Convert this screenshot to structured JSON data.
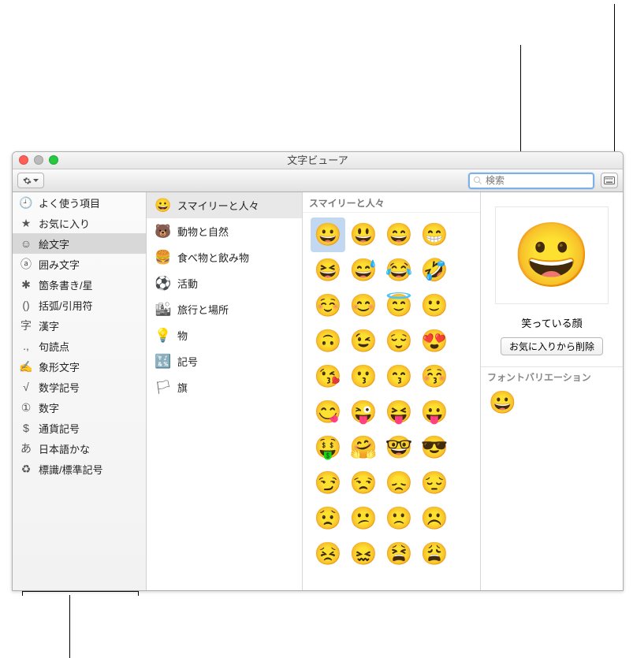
{
  "window_title": "文字ビューア",
  "search_placeholder": "検索",
  "sidebar1": [
    {
      "icon": "🕘",
      "label": "よく使う項目"
    },
    {
      "icon": "★",
      "label": "お気に入り"
    },
    {
      "icon": "☺",
      "label": "絵文字",
      "sel": true
    },
    {
      "icon": "ⓐ",
      "label": "囲み文字"
    },
    {
      "icon": "✱",
      "label": "箇条書き/星"
    },
    {
      "icon": "()",
      "label": "括弧/引用符"
    },
    {
      "icon": "字",
      "label": "漢字"
    },
    {
      "icon": ".,",
      "label": "句読点"
    },
    {
      "icon": "✍",
      "label": "象形文字"
    },
    {
      "icon": "√",
      "label": "数学記号"
    },
    {
      "icon": "①",
      "label": "数字"
    },
    {
      "icon": "$",
      "label": "通貨記号"
    },
    {
      "icon": "あ",
      "label": "日本語かな"
    },
    {
      "icon": "♻",
      "label": "標識/標準記号"
    }
  ],
  "sidebar2": [
    {
      "icon": "😀",
      "label": "スマイリーと人々",
      "sel": true
    },
    {
      "icon": "🐻",
      "label": "動物と自然"
    },
    {
      "icon": "🍔",
      "label": "食べ物と飲み物"
    },
    {
      "icon": "⚽",
      "label": "活動"
    },
    {
      "icon": "🏙",
      "label": "旅行と場所"
    },
    {
      "icon": "💡",
      "label": "物"
    },
    {
      "icon": "🔣",
      "label": "記号"
    },
    {
      "icon": "🏳",
      "label": "旗"
    }
  ],
  "grid_title": "スマイリーと人々",
  "emoji": [
    {
      "c": "😀",
      "sel": true
    },
    "😃",
    "😄",
    "😁",
    "😆",
    "😅",
    "😂",
    "🤣",
    "☺️",
    "😊",
    "😇",
    "🙂",
    "🙃",
    "😉",
    "😌",
    "😍",
    "😘",
    "😗",
    "😙",
    "😚",
    "😋",
    "😜",
    "😝",
    "😛",
    "🤑",
    "🤗",
    "🤓",
    "😎",
    "😏",
    "😒",
    "😞",
    "😔",
    "😟",
    "😕",
    "🙁",
    "☹️",
    "😣",
    "😖",
    "😫",
    "😩"
  ],
  "detail": {
    "char": "😀",
    "name": "笑っている顔",
    "remove_fav": "お気に入りから削除",
    "variations_title": "フォントバリエーション",
    "variation_char": "😀"
  }
}
